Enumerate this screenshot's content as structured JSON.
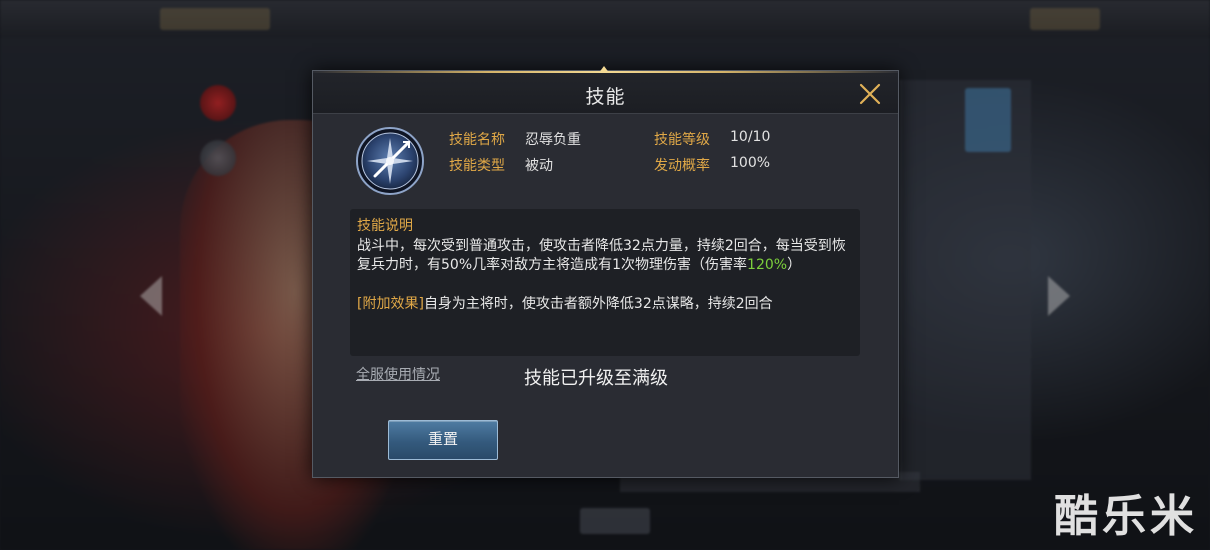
{
  "dialog": {
    "title": "技能",
    "close_icon": "close-x-icon",
    "skill_icon": "skill-compass-icon"
  },
  "skill_info": {
    "name_label": "技能名称",
    "name_value": "忍辱负重",
    "level_label": "技能等级",
    "level_value": "10/10",
    "type_label": "技能类型",
    "type_value": "被动",
    "trigger_label": "发动概率",
    "trigger_value": "100%"
  },
  "description": {
    "title": "技能说明",
    "text_main": "战斗中，每次受到普通攻击，使攻击者降低32点力量，持续2回合，每当受到恢复兵力时，有50%几率对敌方主将造成有1次物理伤害（伤害率",
    "text_rate": "120%",
    "text_close": "）",
    "extra_tag": "[附加效果]",
    "extra_text": "自身为主将时，使攻击者额外降低32点谋略，持续2回合"
  },
  "footer": {
    "usage_link": "全服使用情况",
    "max_level_text": "技能已升级至满级",
    "reset_button": "重置"
  },
  "watermark": "酷乐米",
  "colors": {
    "accent_gold": "#e0a847",
    "highlight_green": "#7ccf3c",
    "button_blue": "#345a7d"
  }
}
